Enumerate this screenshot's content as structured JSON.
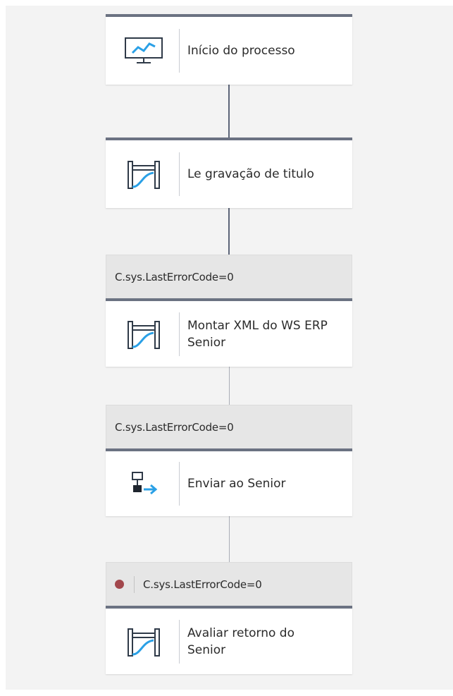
{
  "flow": {
    "nodes": [
      {
        "label": "Início do processo",
        "icon": "monitor-chart-icon"
      },
      {
        "label": "Le gravação de titulo",
        "icon": "gate-line-icon"
      },
      {
        "condition": "C.sys.LastErrorCode=0",
        "label": "Montar XML do WS ERP Senior",
        "icon": "gate-line-icon"
      },
      {
        "condition": "C.sys.LastErrorCode=0",
        "label": "Enviar ao Senior",
        "icon": "send-node-icon"
      },
      {
        "condition": "C.sys.LastErrorCode=0",
        "label": "Avaliar retorno do Senior",
        "icon": "gate-line-icon",
        "breakpoint": true
      }
    ]
  },
  "colors": {
    "accent": "#2aa0e6",
    "header_bar": "#6b7282",
    "breakpoint": "#a2474c"
  }
}
